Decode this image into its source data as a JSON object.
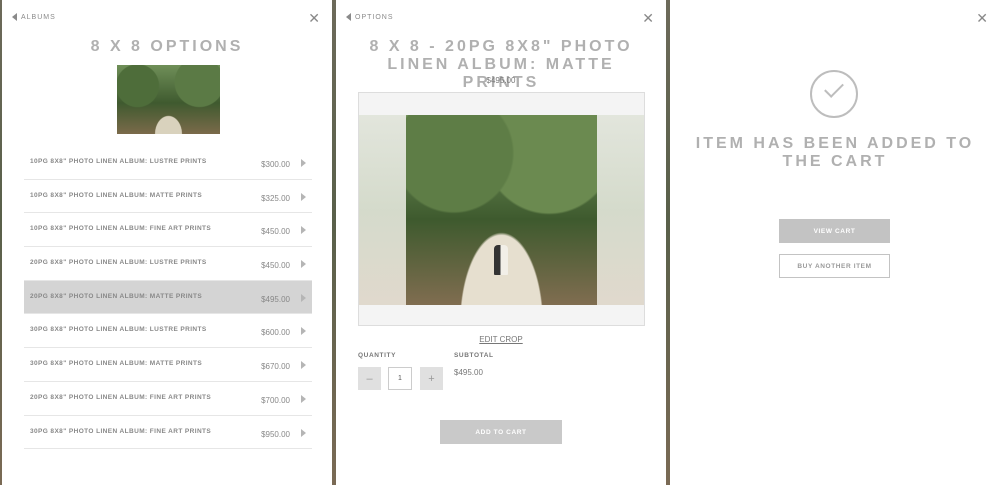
{
  "panel1": {
    "back_label": "ALBUMS",
    "close_label": "✕",
    "title": "8 X 8 OPTIONS",
    "options": [
      {
        "name": "10PG 8X8\" PHOTO LINEN ALBUM: LUSTRE PRINTS",
        "price": "$300.00"
      },
      {
        "name": "10PG 8X8\" PHOTO LINEN ALBUM: MATTE PRINTS",
        "price": "$325.00"
      },
      {
        "name": "10PG 8X8\" PHOTO LINEN ALBUM: FINE ART PRINTS",
        "price": "$450.00"
      },
      {
        "name": "20PG 8X8\" PHOTO LINEN ALBUM: LUSTRE PRINTS",
        "price": "$450.00"
      },
      {
        "name": "20PG 8X8\" PHOTO LINEN ALBUM: MATTE PRINTS",
        "price": "$495.00"
      },
      {
        "name": "30PG 8X8\" PHOTO LINEN ALBUM: LUSTRE PRINTS",
        "price": "$600.00"
      },
      {
        "name": "30PG 8X8\" PHOTO LINEN ALBUM: MATTE PRINTS",
        "price": "$670.00"
      },
      {
        "name": "20PG 8X8\" PHOTO LINEN ALBUM: FINE ART PRINTS",
        "price": "$700.00"
      },
      {
        "name": "30PG 8X8\" PHOTO LINEN ALBUM: FINE ART PRINTS",
        "price": "$950.00"
      }
    ],
    "selected_index": 4
  },
  "panel2": {
    "back_label": "OPTIONS",
    "close_label": "✕",
    "title": "8 X 8 - 20PG 8X8\" PHOTO LINEN ALBUM: MATTE PRINTS",
    "price": "$495.00",
    "edit_crop_label": "EDIT CROP",
    "quantity_label": "QUANTITY",
    "quantity_value": "1",
    "minus_label": "–",
    "plus_label": "+",
    "subtotal_label": "SUBTOTAL",
    "subtotal_value": "$495.00",
    "add_to_cart_label": "ADD TO CART"
  },
  "panel3": {
    "close_label": "✕",
    "message": "ITEM HAS BEEN ADDED TO THE CART",
    "view_cart_label": "VIEW CART",
    "buy_another_label": "BUY ANOTHER ITEM"
  },
  "colors": {
    "panel_bg": "#ffffff",
    "title_gray": "#b0b0b0",
    "selected_row": "#d4d4d4",
    "button_gray": "#c9c9c9"
  }
}
